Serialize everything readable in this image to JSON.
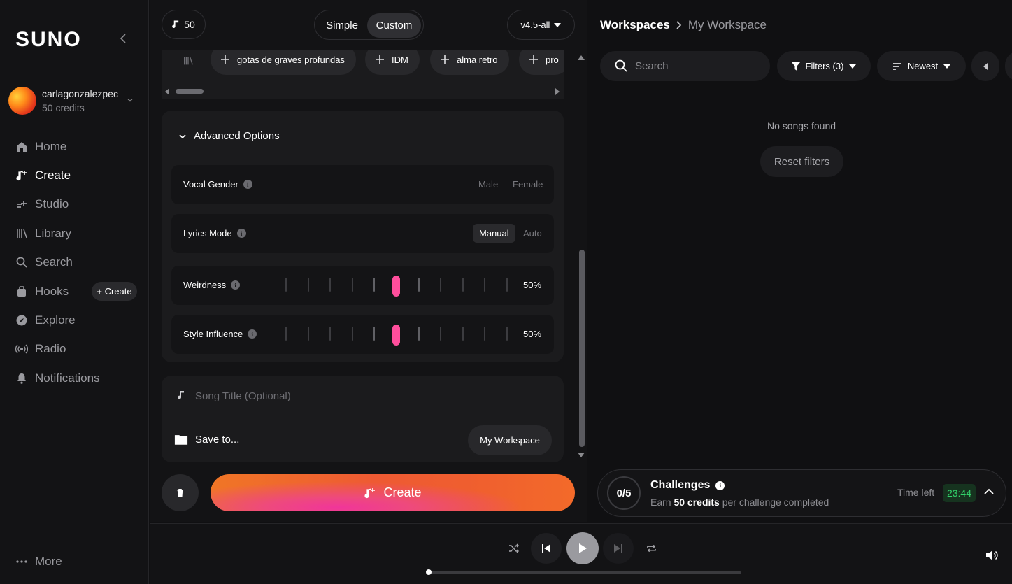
{
  "sidebar": {
    "logo": "SUNO",
    "user": {
      "name": "carlagonzalezpec",
      "credits": "50 credits"
    },
    "nav": [
      {
        "label": "Home",
        "icon": "home-icon"
      },
      {
        "label": "Create",
        "icon": "create-icon",
        "active": true
      },
      {
        "label": "Studio",
        "icon": "studio-icon"
      },
      {
        "label": "Library",
        "icon": "library-icon"
      },
      {
        "label": "Search",
        "icon": "search-icon"
      },
      {
        "label": "Hooks",
        "icon": "hooks-icon"
      },
      {
        "label": "Explore",
        "icon": "explore-icon"
      },
      {
        "label": "Radio",
        "icon": "radio-icon"
      },
      {
        "label": "Notifications",
        "icon": "bell-icon"
      }
    ],
    "hooks_create": "+ Create",
    "more": "More"
  },
  "center": {
    "credits_badge": "50",
    "mode": {
      "simple": "Simple",
      "custom": "Custom",
      "selected": "Custom"
    },
    "model": "v4.5-all",
    "style_tags": [
      "gotas de graves profundas",
      "IDM",
      "alma retro",
      "pro"
    ],
    "advanced": {
      "title": "Advanced Options",
      "vocal_gender": {
        "label": "Vocal Gender",
        "options": [
          "Male",
          "Female"
        ]
      },
      "lyrics_mode": {
        "label": "Lyrics Mode",
        "options": [
          "Manual",
          "Auto"
        ],
        "selected": "Manual"
      },
      "weirdness": {
        "label": "Weirdness",
        "value": "50%",
        "level": 0.5
      },
      "style_influence": {
        "label": "Style Influence",
        "value": "50%",
        "level": 0.5
      }
    },
    "song_title_placeholder": "Song Title (Optional)",
    "save_to": {
      "label": "Save to...",
      "workspace": "My Workspace"
    },
    "create_label": "Create"
  },
  "right": {
    "breadcrumb": {
      "root": "Workspaces",
      "current": "My Workspace"
    },
    "search_placeholder": "Search",
    "filters": "Filters (3)",
    "sort": "Newest",
    "empty_message": "No songs found",
    "reset_label": "Reset filters",
    "challenges": {
      "progress": "0/5",
      "title": "Challenges",
      "subtitle_pre": "Earn",
      "subtitle_bold": "50 credits",
      "subtitle_post": "per challenge completed",
      "time_left_label": "Time left",
      "timer": "23:44"
    }
  },
  "colors": {
    "accent_pink": "#ff4e9c",
    "create_orange": "#f07626",
    "timer_green": "#32d26a"
  }
}
